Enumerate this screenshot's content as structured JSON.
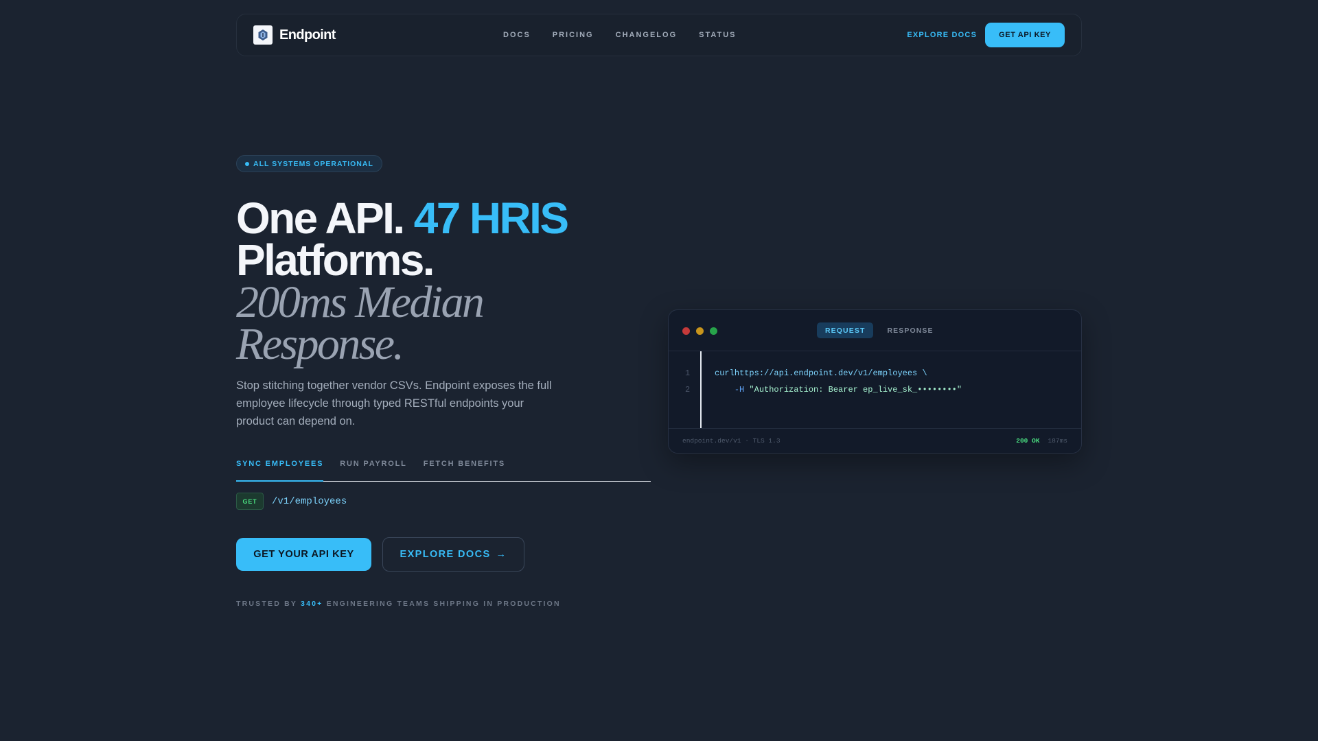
{
  "nav": {
    "brand": "Endpoint",
    "links": [
      "DOCS",
      "PRICING",
      "CHANGELOG",
      "STATUS"
    ],
    "explore": "EXPLORE DOCS",
    "cta": "GET API KEY"
  },
  "badge": "ALL SYSTEMS OPERATIONAL",
  "hero": {
    "line1_a": "One API.",
    "line1_b": "47 HRIS",
    "line2": "Platforms.",
    "line3": "200ms Median",
    "line4": "Response.",
    "lede": "Stop stitching together vendor CSVs. Endpoint exposes the full employee lifecycle through typed RESTful endpoints your product can depend on."
  },
  "tabs": [
    "SYNC EMPLOYEES",
    "RUN PAYROLL",
    "FETCH BENEFITS"
  ],
  "endpoint": {
    "method": "GET",
    "path": "/v1/employees"
  },
  "cta": {
    "primary": "GET YOUR API KEY",
    "secondary": "EXPLORE DOCS",
    "secondary_arrow": "→"
  },
  "trusted": {
    "prefix": "TRUSTED BY",
    "count": "340+",
    "suffix": "ENGINEERING TEAMS SHIPPING IN PRODUCTION"
  },
  "code": {
    "tabs": [
      "REQUEST",
      "RESPONSE"
    ],
    "lines": [
      {
        "num": "1",
        "cmd": "curl",
        "url": "https://api.endpoint.dev/v1/employees \\"
      },
      {
        "num": "2",
        "flag": "-H",
        "value": "\"Authorization: Bearer ep_live_sk_••••••••\""
      }
    ],
    "footer_left": "endpoint.dev/v1 · TLS 1.3",
    "footer_status": "200 OK",
    "footer_time": "187ms"
  },
  "colors": {
    "accent": "#38bdf8",
    "background": "#1b2330",
    "success": "#4ade80"
  },
  "icons": {
    "logo": "endpoint-logo-icon"
  }
}
